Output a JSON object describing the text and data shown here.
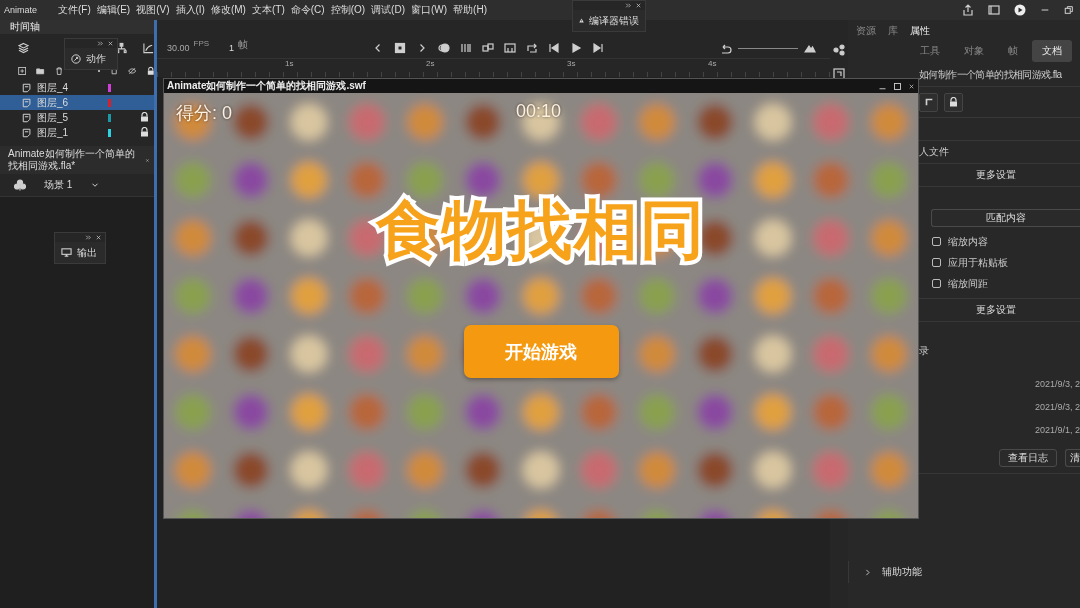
{
  "menu_bar": {
    "app_name": "Animate",
    "items": [
      "文件(F)",
      "编辑(E)",
      "视图(V)",
      "插入(I)",
      "修改(M)",
      "文本(T)",
      "命令(C)",
      "控制(O)",
      "调试(D)",
      "窗口(W)",
      "帮助(H)"
    ]
  },
  "timeline": {
    "tab": "时间轴",
    "fps": "30.00",
    "fps_unit": "FPS",
    "frame": "1",
    "frame_unit": "帧",
    "ruler": [
      "1s",
      "2s",
      "3s",
      "4s"
    ],
    "layers": [
      {
        "name": "图层_4",
        "color": "#d23fd6",
        "locked": false,
        "selected": false
      },
      {
        "name": "图层_6",
        "color": "#d8202a",
        "locked": false,
        "selected": true
      },
      {
        "name": "图层_5",
        "color": "#1a9aa6",
        "locked": true,
        "selected": false
      },
      {
        "name": "图层_1",
        "color": "#2fd2e0",
        "locked": true,
        "selected": false
      }
    ]
  },
  "actions_panel": {
    "label": "动作"
  },
  "compiler_panel": {
    "label": "编译器错误"
  },
  "output_panel": {
    "label": "输出"
  },
  "document_tab": {
    "title": "Animate如何制作一个简单的找相同游戏.fla*"
  },
  "scene": {
    "label": "场景 1"
  },
  "player_window": {
    "title": "Animate如何制作一个简单的找相同游戏.swf",
    "score": "得分: 0",
    "timer": "00:10",
    "game_title": "食物找相同",
    "start_button": "开始游戏"
  },
  "properties_panel": {
    "panel_tabs": [
      {
        "label": "资源",
        "selected": false
      },
      {
        "label": "库",
        "selected": false
      },
      {
        "label": "属性",
        "selected": true
      }
    ],
    "tabs": [
      {
        "label": "工具",
        "selected": false
      },
      {
        "label": "对象",
        "selected": false
      },
      {
        "label": "帧",
        "selected": false
      },
      {
        "label": "文档",
        "selected": true
      }
    ],
    "document_name": "如何制作一个简单的找相同游戏.fla",
    "file_label": "人文件",
    "more_settings_1": "更多设置",
    "match_button": "匹配内容",
    "options": [
      {
        "label": "缩放内容",
        "checked": false
      },
      {
        "label": "应用于粘贴板",
        "checked": false
      },
      {
        "label": "缩放间距",
        "checked": false
      }
    ],
    "more_settings_2": "更多设置",
    "history_label": "录",
    "history": [
      "2021/9/3, 2",
      "2021/9/3, 2",
      "2021/9/1, 2"
    ],
    "buttons": [
      "查看日志",
      "清"
    ],
    "accessibility": "辅助功能"
  }
}
